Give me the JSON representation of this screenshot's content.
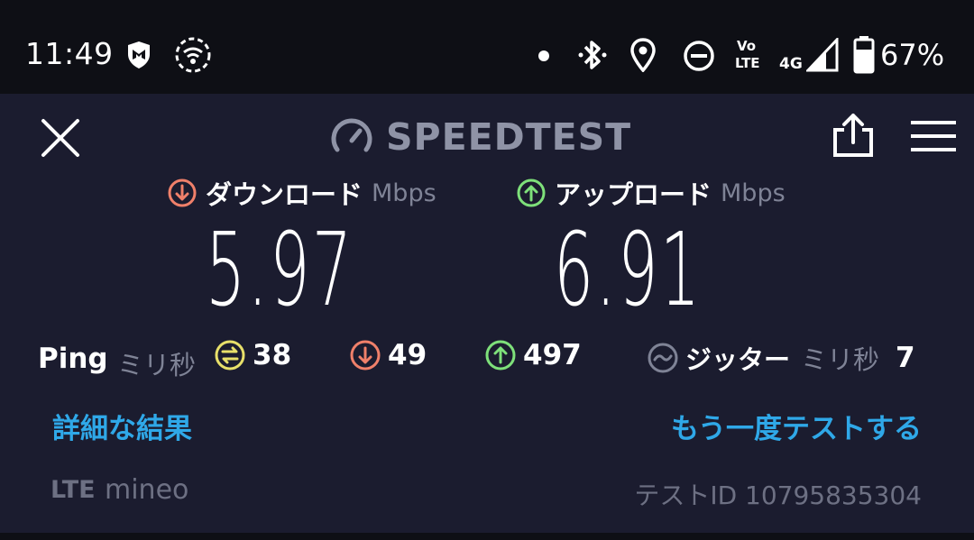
{
  "status_bar": {
    "time": "11:49",
    "network_label": "4G",
    "volte_label_top": "Vo",
    "volte_label_bottom": "LTE",
    "battery_percent": "67%",
    "icons": [
      "mcafee-shield-icon",
      "wifi-signal-icon",
      "notification-dot-icon",
      "bluetooth-icon",
      "location-pin-icon",
      "do-not-disturb-icon",
      "volte-icon",
      "cell-signal-icon",
      "battery-icon"
    ]
  },
  "header": {
    "logo_text": "SPEEDTEST",
    "close_icon": "close-icon",
    "share_icon": "share-icon",
    "menu_icon": "hamburger-menu-icon"
  },
  "download": {
    "label": "ダウンロード",
    "unit": "Mbps",
    "value": "5.97",
    "color": "#f0806a"
  },
  "upload": {
    "label": "アップロード",
    "unit": "Mbps",
    "value": "6.91",
    "color": "#7ee07a"
  },
  "ping": {
    "label": "Ping",
    "unit": "ミリ秒",
    "idle": "38",
    "download": "49",
    "upload": "497",
    "idle_color": "#e8e06a"
  },
  "jitter": {
    "label": "ジッター",
    "unit": "ミリ秒",
    "value": "7"
  },
  "links": {
    "details": "詳細な結果",
    "retest": "もう一度テストする"
  },
  "provider": {
    "tech": "LTE",
    "name": "mineo"
  },
  "test_id": "テストID 10795835304",
  "colors": {
    "background": "#1b1c2f",
    "status_bar": "#0e0f15",
    "link": "#2fa8e8",
    "muted": "#7f8396"
  }
}
